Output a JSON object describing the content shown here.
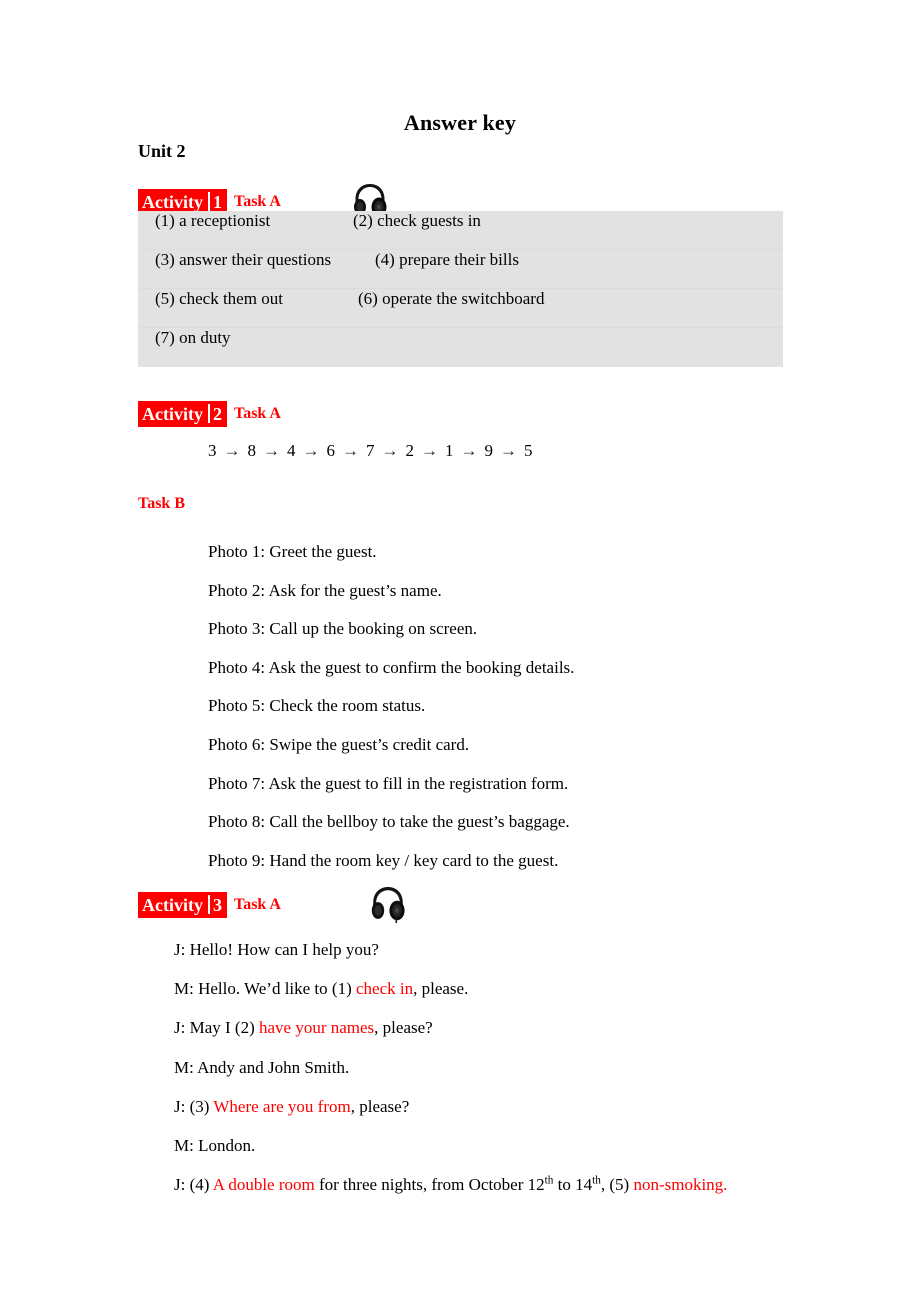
{
  "document": {
    "title": "Answer key",
    "unit_heading": "Unit 2"
  },
  "colors": {
    "highlight_red": "#ff0000",
    "answer_block_gray": "#e2e2e2",
    "text_black": "#000000"
  },
  "activity1": {
    "badge_word": "Activity",
    "badge_number": "1",
    "task_label": "Task A",
    "icon": "headphones-icon",
    "answers": [
      {
        "left": "(1) a receptionist",
        "right": "(2) check guests in"
      },
      {
        "left": "(3) answer their questions",
        "right": "(4) prepare their bills"
      },
      {
        "left": "(5) check them out",
        "right": "(6) operate the switchboard"
      },
      {
        "left": "(7) on duty",
        "right": ""
      }
    ]
  },
  "activity2": {
    "badge_word": "Activity",
    "badge_number": "2",
    "task_a_label": "Task A",
    "task_b_label": "Task B",
    "sequence": [
      "3",
      "8",
      "4",
      "6",
      "7",
      "2",
      "1",
      "9",
      "5"
    ],
    "sequence_arrow": "→",
    "task_b_items": [
      "Photo 1: Greet the guest.",
      "Photo 2: Ask for the guest’s name.",
      "Photo 3: Call up the booking on screen.",
      "Photo 4: Ask the guest to confirm the booking details.",
      "Photo 5: Check the room status.",
      "Photo 6: Swipe the guest’s credit card.",
      "Photo 7: Ask the guest to fill in the registration form.",
      "Photo 8: Call the bellboy to take the guest’s baggage.",
      "Photo 9: Hand the room key / key card to the guest."
    ]
  },
  "activity3": {
    "badge_word": "Activity",
    "badge_number": "3",
    "task_label": "Task A",
    "icon": "headphones-icon",
    "dialogue": [
      {
        "plain1": "J: Hello! How can I help you?",
        "red": "",
        "plain2": ""
      },
      {
        "plain1": "M: Hello. We’d like to (1) ",
        "red": "check in",
        "plain2": ", please."
      },
      {
        "plain1": "J: May I (2) ",
        "red": "have your names",
        "plain2": ", please?"
      },
      {
        "plain1": "M: Andy and John Smith.",
        "red": "",
        "plain2": ""
      },
      {
        "plain1": "J: (3) ",
        "red": "Where are you from",
        "plain2": ", please?"
      },
      {
        "plain1": "M: London.",
        "red": "",
        "plain2": ""
      }
    ],
    "last_line": {
      "prefix": "J: (4) ",
      "red1": "A double room",
      "middle_a": " for three nights, from October 12",
      "sup1": "th",
      "middle_b": " to 14",
      "sup2": "th",
      "middle_c": ", (5) ",
      "red2": "non-smoking."
    }
  }
}
